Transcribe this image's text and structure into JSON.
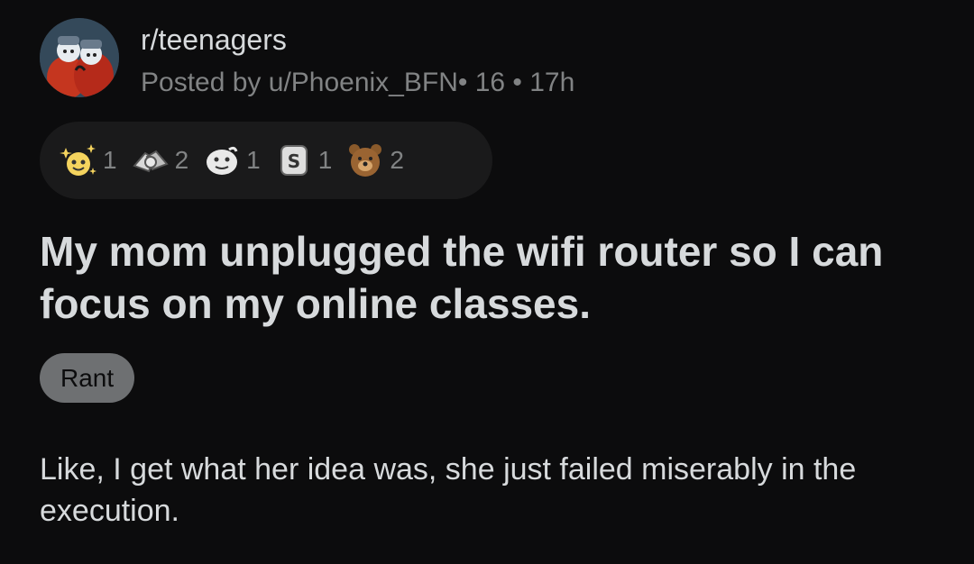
{
  "post": {
    "subreddit": "r/teenagers",
    "meta": "Posted by u/Phoenix_BFN• 16 • 17h",
    "title": "My mom unplugged the wifi router so I can focus on my online classes.",
    "flair": "Rant",
    "body": "Like, I get what her idea was, she just failed miserably in the execution."
  },
  "awards": [
    {
      "icon": "wholesome-sparkle-icon",
      "count": "1"
    },
    {
      "icon": "handshake-icon",
      "count": "2"
    },
    {
      "icon": "face-emoji-icon",
      "count": "1"
    },
    {
      "icon": "coin-s-icon",
      "count": "1"
    },
    {
      "icon": "bear-icon",
      "count": "2"
    }
  ],
  "colors": {
    "background": "#0c0c0d",
    "text_primary": "#d7dadc",
    "text_secondary": "#818384",
    "award_bar": "#1a1a1b",
    "flair_bg": "#6e7072"
  }
}
